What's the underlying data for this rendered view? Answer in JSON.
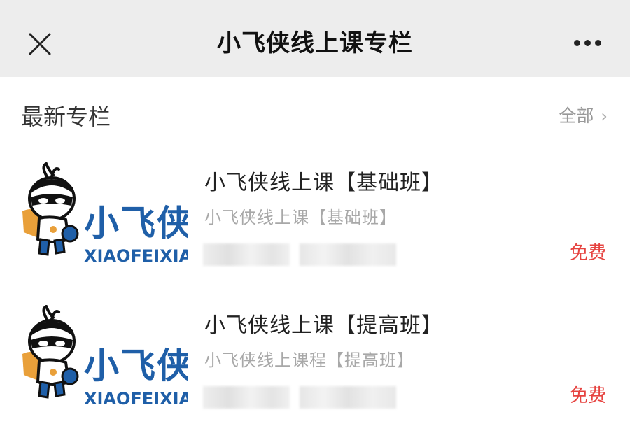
{
  "header": {
    "title": "小飞侠线上课专栏",
    "close_icon": "close-icon",
    "more_icon": "more-dots-icon"
  },
  "section": {
    "title": "最新专栏",
    "view_all_label": "全部",
    "view_all_icon": "chevron-right-icon"
  },
  "logo": {
    "brand_text": "小飞侠",
    "brand_latin": "XIAOFEIXIA"
  },
  "columns": [
    {
      "title": "小飞侠线上课【基础班】",
      "subtitle": "小飞侠线上课【基础班】",
      "price": "免费"
    },
    {
      "title": "小飞侠线上课【提高班】",
      "subtitle": "小飞侠线上课程【提高班】",
      "price": "免费"
    }
  ],
  "colors": {
    "header_bg": "#ededed",
    "price": "#e64340",
    "logo_blue": "#1f5fa8",
    "logo_orange": "#e9a03a"
  }
}
